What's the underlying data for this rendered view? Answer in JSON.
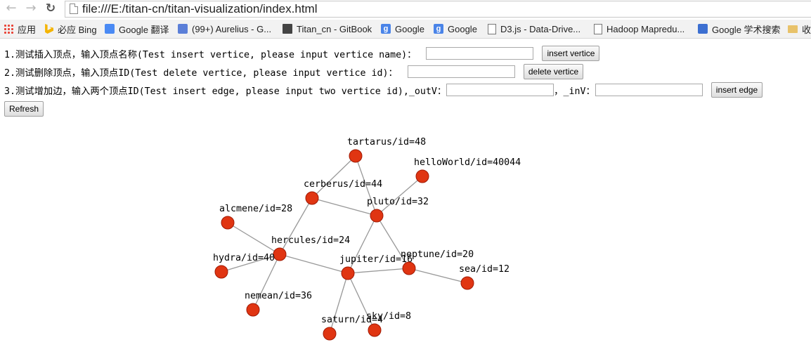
{
  "browser": {
    "url": "file:///E:/titan-cn/titan-visualization/index.html",
    "bookmarks": [
      {
        "label": "应用",
        "icon": "apps-grid-icon"
      },
      {
        "label": "必应 Bing",
        "icon": "bing-icon"
      },
      {
        "label": "Google 翻译",
        "icon": "google-translate-icon"
      },
      {
        "label": "(99+) Aurelius - G...",
        "icon": "chat-icon"
      },
      {
        "label": "Titan_cn - GitBook",
        "icon": "gitbook-icon"
      },
      {
        "label": "Google",
        "icon": "google-icon"
      },
      {
        "label": "Google",
        "icon": "google-icon"
      },
      {
        "label": "D3.js - Data-Drive...",
        "icon": "page-icon"
      },
      {
        "label": "Hadoop Mapredu...",
        "icon": "page-icon"
      },
      {
        "label": "Google 学术搜索",
        "icon": "google-scholar-icon"
      },
      {
        "label": "收",
        "icon": "folder-icon"
      }
    ]
  },
  "form": {
    "insert_label": "1.测试插入顶点，输入顶点名称(Test insert vertice, please input vertice name)：",
    "insert_button": "insert vertice",
    "delete_label": "2.测试删除顶点，输入顶点ID(Test delete vertice, please input vertice id)：",
    "delete_button": "delete vertice",
    "edge_label": "3.测试增加边，输入两个顶点ID(Test insert edge, please input two vertice id), ",
    "outv_label": "_outV：",
    "inv_label": "，_inV：",
    "edge_button": "insert edge",
    "refresh_button": "Refresh"
  },
  "graph": {
    "node_color": "#e03512",
    "edge_color": "#999999",
    "nodes": [
      {
        "label": "tartarus/id=48"
      },
      {
        "label": "helloWorld/id=40044"
      },
      {
        "label": "cerberus/id=44"
      },
      {
        "label": "pluto/id=32"
      },
      {
        "label": "alcmene/id=28"
      },
      {
        "label": "hercules/id=24"
      },
      {
        "label": "hydra/id=40"
      },
      {
        "label": "jupiter/id=16"
      },
      {
        "label": "neptune/id=20"
      },
      {
        "label": "sea/id=12"
      },
      {
        "label": "nemean/id=36"
      },
      {
        "label": "saturn/id=4"
      },
      {
        "label": "sky/id=8"
      }
    ],
    "edges": [
      [
        "tartarus/id=48",
        "cerberus/id=44"
      ],
      [
        "tartarus/id=48",
        "pluto/id=32"
      ],
      [
        "helloWorld/id=40044",
        "pluto/id=32"
      ],
      [
        "cerberus/id=44",
        "pluto/id=32"
      ],
      [
        "cerberus/id=44",
        "hercules/id=24"
      ],
      [
        "pluto/id=32",
        "jupiter/id=16"
      ],
      [
        "pluto/id=32",
        "neptune/id=20"
      ],
      [
        "alcmene/id=28",
        "hercules/id=24"
      ],
      [
        "hercules/id=24",
        "hydra/id=40"
      ],
      [
        "hercules/id=24",
        "nemean/id=36"
      ],
      [
        "hercules/id=24",
        "jupiter/id=16"
      ],
      [
        "jupiter/id=16",
        "neptune/id=20"
      ],
      [
        "jupiter/id=16",
        "saturn/id=4"
      ],
      [
        "jupiter/id=16",
        "sky/id=8"
      ],
      [
        "neptune/id=20",
        "sea/id=12"
      ]
    ]
  }
}
